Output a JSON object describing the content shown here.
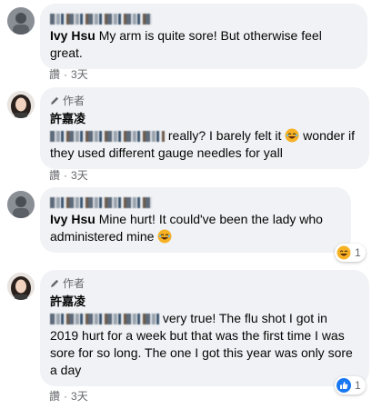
{
  "comments": [
    {
      "reply_to_label": "Ivy Hsu",
      "text": "My arm is quite sore! But otherwise feel great.",
      "action": "讚",
      "time": "3天"
    },
    {
      "author_badge": "作者",
      "author_name": "許嘉凌",
      "text": "really? I barely felt it",
      "text_after_emoji": "wonder if they used different gauge needles for yall",
      "action": "讚",
      "time": "3天"
    },
    {
      "reply_to_label": "Ivy Hsu",
      "text": "Mine hurt! It could've been the lady who administered mine",
      "reaction_count": "1"
    },
    {
      "author_badge": "作者",
      "author_name": "許嘉凌",
      "text": "very true! The flu shot I got in 2019 hurt for a week but that was the first time I was sore for so long. The one I got this year was only sore a day",
      "action": "讚",
      "time": "3天",
      "reaction_count": "1"
    }
  ],
  "colors": {
    "bubble": "#f0f2f5",
    "meta_text": "#65676b",
    "like_blue": "#1877f2",
    "haha_yellow": "#f7b125"
  }
}
